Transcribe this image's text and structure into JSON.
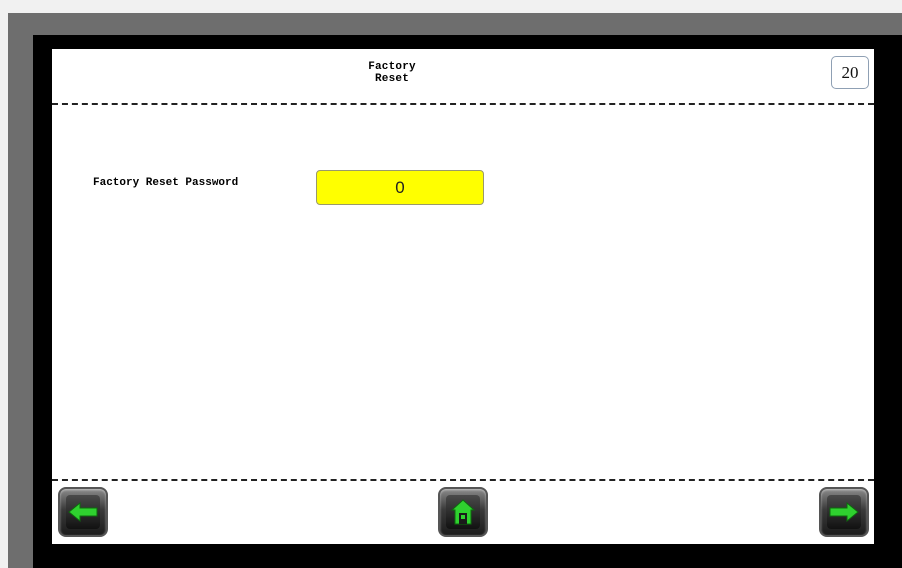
{
  "header": {
    "title": "Factory Reset",
    "page_number": "20"
  },
  "form": {
    "password_label": "Factory Reset Password",
    "password_value": "0"
  },
  "navigation": {
    "back_icon": "left-arrow-icon",
    "home_icon": "home-icon",
    "next_icon": "right-arrow-icon"
  },
  "colors": {
    "input_background": "#ffff00",
    "icon_green": "#2fd12f",
    "bezel": "#000000"
  }
}
